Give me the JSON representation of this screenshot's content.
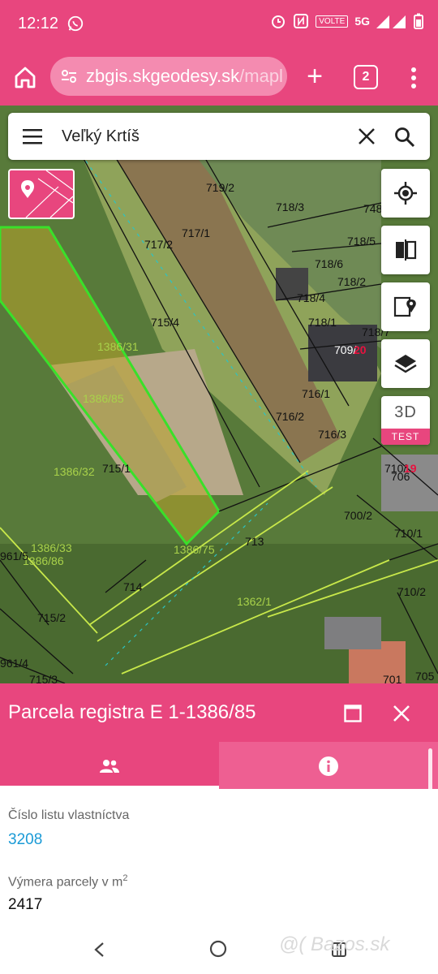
{
  "status_bar": {
    "time": "12:12",
    "icons": [
      "whatsapp-icon",
      "alarm-icon",
      "nfc-icon",
      "volte-icon",
      "5g-icon",
      "signal-icon",
      "battery-icon"
    ],
    "volte": "VOLTE",
    "network": "5G"
  },
  "browser": {
    "url_main": "zbgis.skgeodesy.sk",
    "url_path": "/mapl",
    "tab_count": "2"
  },
  "search": {
    "query": "Veľký Krtíš"
  },
  "map": {
    "parcel_labels": [
      "719/2",
      "718/3",
      "748",
      "717/1",
      "717/2",
      "718/5",
      "718/6",
      "718/2",
      "718/4",
      "715/4",
      "718/1",
      "718/7",
      "709/",
      "20",
      "1386/31",
      "1386/85",
      "716/1",
      "716/2",
      "716/3",
      "1386/32",
      "715/1",
      "3D",
      "710/",
      "19",
      "706",
      "700/2",
      "710/1",
      "713",
      "1386/33",
      "1386/86",
      "1386/75",
      "961/5",
      "714",
      "1362/1",
      "710/2",
      "715/2",
      "961/4",
      "715/3",
      "701",
      "705"
    ],
    "button_3d": "3D",
    "button_test": "TEST"
  },
  "panel": {
    "title": "Parcela registra E 1-1386/85",
    "fields": [
      {
        "label": "Číslo listu vlastníctva",
        "value": "3208"
      },
      {
        "label": "Výmera parcely v m",
        "sup": "2",
        "value": "2417"
      }
    ]
  },
  "watermark": "@( Bazos.sk",
  "colors": {
    "accent": "#e8467e",
    "link": "#1a9ad6",
    "parcel_highlight": "#b9a329",
    "parcel_border": "#39e02a"
  }
}
